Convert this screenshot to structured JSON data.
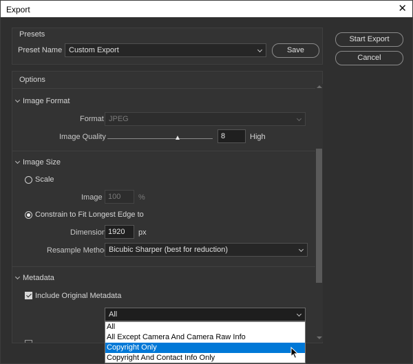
{
  "window": {
    "title": "Export",
    "close_glyph": "✕"
  },
  "presets": {
    "heading": "Presets",
    "preset_name_label": "Preset Name",
    "preset_value": "Custom Export",
    "save_label": "Save"
  },
  "actions": {
    "start_export": "Start Export",
    "cancel": "Cancel"
  },
  "options": {
    "heading": "Options",
    "image_format": {
      "heading": "Image Format",
      "format_label": "Format",
      "format_value": "JPEG",
      "quality_label": "Image Quality",
      "quality_value": "8",
      "quality_max": "12",
      "quality_text": "High"
    },
    "image_size": {
      "heading": "Image Size",
      "scale_label": "Scale",
      "image_label": "Image",
      "image_value": "100",
      "percent_unit": "%",
      "constrain_label": "Constrain to Fit Longest Edge to",
      "dimension_label": "Dimension",
      "dimension_value": "1920",
      "px_unit": "px",
      "resample_label": "Resample Method",
      "resample_value": "Bicubic Sharper (best for reduction)"
    },
    "metadata": {
      "heading": "Metadata",
      "include_label": "Include Original Metadata",
      "selected_value": "All",
      "dropdown_options": [
        "All",
        "All Except Camera And Camera Raw Info",
        "Copyright Only",
        "Copyright And Contact Info Only"
      ],
      "highlighted_option": "Copyright Only"
    }
  },
  "colors": {
    "background": "#2f2f2f",
    "panel": "#333333",
    "highlight": "#0078d7"
  }
}
